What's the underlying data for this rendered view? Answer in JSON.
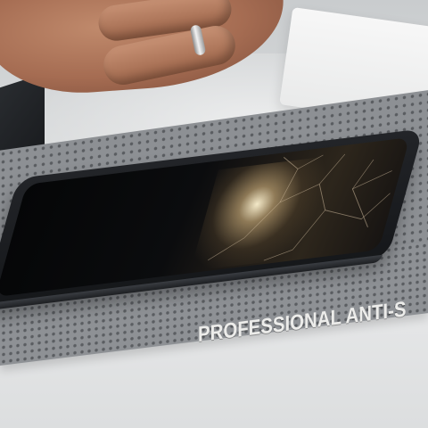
{
  "scene": {
    "description_label": "",
    "mat_label": "PROFESSIONAL ANTI-S",
    "colors": {
      "mat": "#8d9094",
      "phone_body": "#1d1f22",
      "skin": "#b07a5f",
      "table": "#dcdedf"
    }
  }
}
